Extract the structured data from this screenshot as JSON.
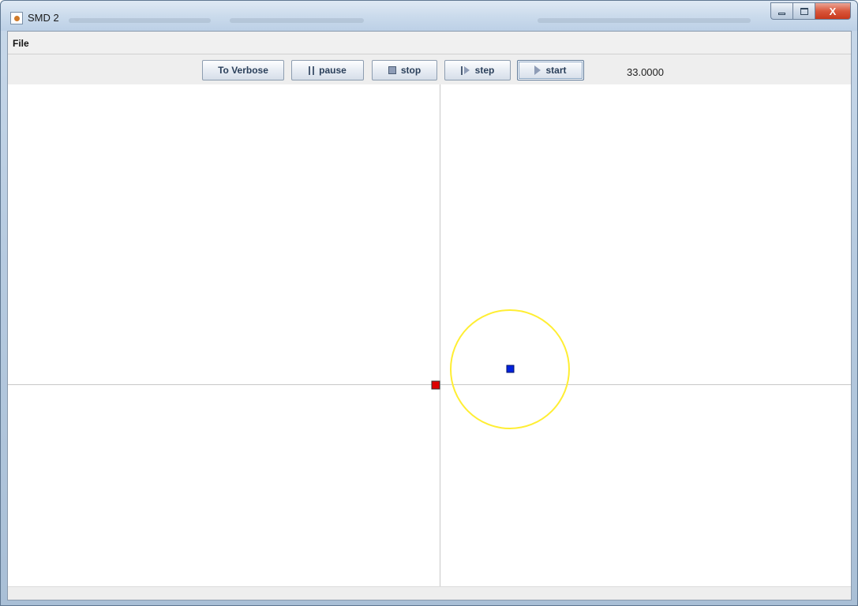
{
  "window": {
    "title": "SMD 2",
    "close_glyph": "X"
  },
  "menu": {
    "file_label": "File"
  },
  "toolbar": {
    "verbose_label": "To Verbose",
    "pause_label": "pause",
    "stop_label": "stop",
    "step_label": "step",
    "start_label": "start",
    "time_readout": "33.0000"
  },
  "simulation": {
    "circle_color": "#ffee33",
    "source_color": "#dd0000",
    "particle_color": "#0022dd",
    "axis_color": "#c8c8c8"
  }
}
